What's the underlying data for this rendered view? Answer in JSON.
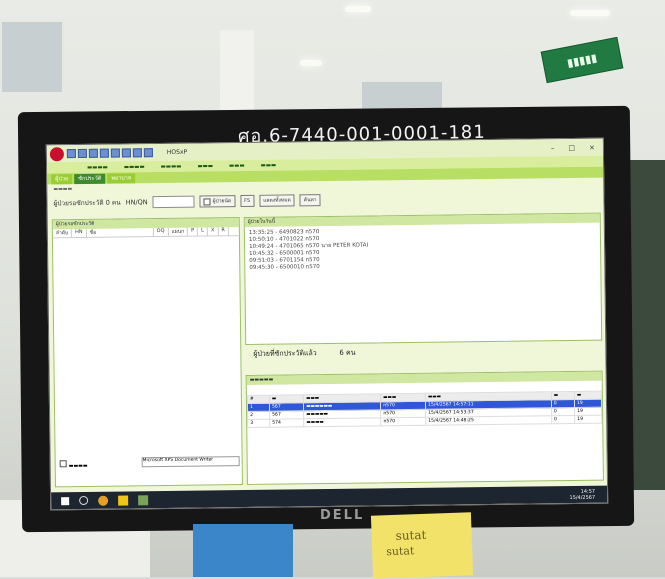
{
  "monitor_label": "ศอ.6-7440-001-0001-181",
  "brand": "DELL",
  "app": {
    "title": "HOSxP",
    "window_controls": [
      "–",
      "□",
      "×"
    ],
    "tabs": [
      {
        "label": "ผู้ป่วย",
        "active": false
      },
      {
        "label": "ซักประวัติ",
        "active": true
      },
      {
        "label": "พยาบาล",
        "active": false
      }
    ],
    "queue_label": "ผู้ป่วยรอซักประวัติ 0 คน",
    "hn_label": "HN/QN",
    "buttons": [
      "ผู้ป่วยนัด",
      "F5",
      "แสดงทั้งหมด",
      "ค้นหา"
    ],
    "left_panel_title": "ผู้ป่วยรอซักประวัติ",
    "left_columns": [
      "ลำดับ",
      "HN",
      "ชื่อ",
      "OQ",
      "แผนก",
      "P",
      "L",
      "X",
      "R"
    ],
    "right_panel_title": "ผู้ป่วยในวันนี้",
    "log_lines": [
      "13:35:25 - 6490823 n570",
      "10:50:10 - 4701022 n570",
      "10:49:24 - 4701065 n570 นาย PETER KOTAI",
      "10:45:32 - 6500001 n570",
      "09:51:03 - 6701154 n570",
      "09:45:30 - 6500010 n570"
    ],
    "completed_label": "ผู้ป่วยที่ซักประวัติแล้ว",
    "completed_count": "6 คน",
    "bottom_table": [
      [
        "1",
        "567",
        "n570",
        "15/4/2567 14:57:11",
        "0",
        "19"
      ],
      [
        "2",
        "567",
        "n570",
        "15/4/2567 14:53:37",
        "0",
        "19"
      ],
      [
        "3",
        "574",
        "n570",
        "15/4/2567 14:48:25",
        "0",
        "19"
      ]
    ],
    "dropdown_value": "Microsoft XPS Document Writer",
    "clock_time": "14:57",
    "clock_date": "15/4/2567"
  },
  "sticky_notes": [
    {
      "text": "sutat"
    },
    {
      "text": "sutat"
    }
  ],
  "colors": {
    "screen_bg": "#f0f6d8",
    "selected_row": "#2f57d8",
    "sign_green": "#227a43"
  }
}
